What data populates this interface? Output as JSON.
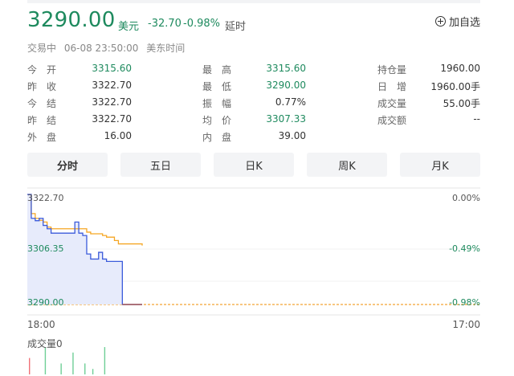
{
  "header": {
    "price": "3290.00",
    "currency": "美元",
    "change": "-32.70",
    "change_pct": "-0.98%",
    "delay": "延时",
    "add_watch": "加自选"
  },
  "status": {
    "state": "交易中",
    "time": "06-08 23:50:00",
    "zone": "美东时间"
  },
  "stats": [
    [
      {
        "label": "今　开",
        "value": "3315.60"
      },
      {
        "label": "最　高",
        "value": "3315.60"
      },
      {
        "label": "持仓量",
        "value": "1960.00"
      }
    ],
    [
      {
        "label": "昨　收",
        "value": "3322.70"
      },
      {
        "label": "最　低",
        "value": "3290.00"
      },
      {
        "label": "日　增",
        "value": "1960.00手"
      }
    ],
    [
      {
        "label": "今　结",
        "value": "3322.70"
      },
      {
        "label": "振　幅",
        "value": "0.77%"
      },
      {
        "label": "成交量",
        "value": "55.00手"
      }
    ],
    [
      {
        "label": "昨　结",
        "value": "3322.70"
      },
      {
        "label": "均　价",
        "value": "3307.33"
      },
      {
        "label": "成交额",
        "value": "--"
      }
    ],
    [
      {
        "label": "外　盘",
        "value": "16.00"
      },
      {
        "label": "内　盘",
        "value": "39.00"
      }
    ]
  ],
  "tabs": [
    "分时",
    "五日",
    "日K",
    "周K",
    "月K"
  ],
  "chart_data": {
    "type": "line",
    "y_labels_left": [
      "3322.70",
      "3306.35",
      "3290.00"
    ],
    "y_labels_right": [
      "0.00%",
      "-0.49%",
      "-0.98%"
    ],
    "x_labels": [
      "18:00",
      "17:00"
    ],
    "ylim": [
      3290.0,
      3322.7
    ],
    "x": [
      0,
      1,
      2,
      3,
      4,
      5,
      6,
      7,
      8,
      9,
      10,
      11,
      12,
      13,
      14,
      15,
      16,
      17,
      18,
      19,
      20,
      21,
      22,
      23,
      24,
      25,
      26,
      27,
      28,
      29
    ],
    "series": [
      {
        "values": [
          3322.7,
          3315.6,
          3314.9,
          3315.6,
          3313.5,
          3312.5,
          3311.2,
          3311.2,
          3311.2,
          3311.2,
          3311.2,
          3311.2,
          3314.5,
          3311.2,
          3310.5,
          3305.0,
          3303.5,
          3303.5,
          3305.5,
          3303.5,
          3302.8,
          3302.8,
          3302.8,
          3302.8,
          3290.0,
          3290.0,
          3290.0,
          3290.0,
          3290.0,
          3290.0
        ]
      },
      {
        "values": [
          3322.7,
          3317.0,
          3315.6,
          3315.0,
          3314.5,
          3313.0,
          3312.5,
          3312.5,
          3312.5,
          3312.5,
          3312.5,
          3312.5,
          3312.5,
          3312.5,
          3312.5,
          3311.5,
          3311.0,
          3311.0,
          3311.0,
          3310.5,
          3310.0,
          3310.0,
          3309.0,
          3308.0,
          3308.0,
          3308.0,
          3308.0,
          3308.0,
          3308.0,
          3307.5
        ]
      }
    ],
    "reference_line": 3290.0,
    "grid": true,
    "volume_label": "成交量0",
    "volume": [
      3,
      0,
      0,
      0,
      5,
      0,
      0,
      0,
      2,
      0,
      0,
      4,
      0,
      0,
      2,
      0,
      1,
      0,
      0,
      5,
      0,
      0,
      0,
      0,
      0,
      0,
      0,
      0,
      0,
      0
    ]
  },
  "colors": {
    "up_down_green": "#1e8a5e",
    "price_line": "#3b5bdb",
    "avg_line": "#f5a623",
    "ref_line": "#f08c00",
    "volume_green": "#6fcf97",
    "volume_red": "#f07178"
  }
}
